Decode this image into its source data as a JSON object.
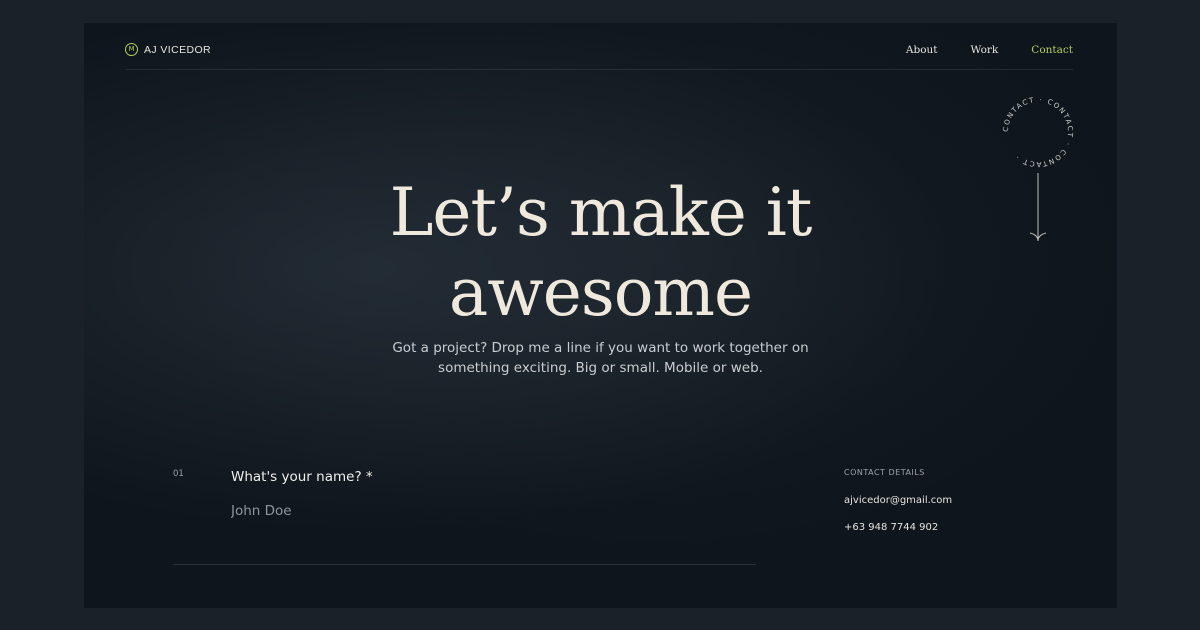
{
  "nav": {
    "logo_text": "AJ VICEDOR",
    "logo_glyph": "M",
    "links": [
      {
        "label": "About",
        "active": false
      },
      {
        "label": "Work",
        "active": false
      },
      {
        "label": "Contact",
        "active": true
      }
    ]
  },
  "badge": {
    "ring_text": "CONTACT · CONTACT · CONTACT ·",
    "icon": "arrow-down-icon"
  },
  "hero": {
    "title_line1": "Let’s make it",
    "title_line2": "awesome",
    "subtitle": "Got a project? Drop me a line if you want to work together on\nsomething exciting.  Big or small. Mobile or web."
  },
  "form": {
    "step_number": "01",
    "question": "What's your name? *",
    "placeholder": "John Doe"
  },
  "contact": {
    "heading": "CONTACT DETAILS",
    "email": "ajvicedor@gmail.com",
    "phone": "+63 948 7744 902"
  },
  "colors": {
    "accent": "#b5cc5a",
    "background": "#0f151c",
    "outer_background": "#1a2128",
    "text": "#efe9dd"
  }
}
